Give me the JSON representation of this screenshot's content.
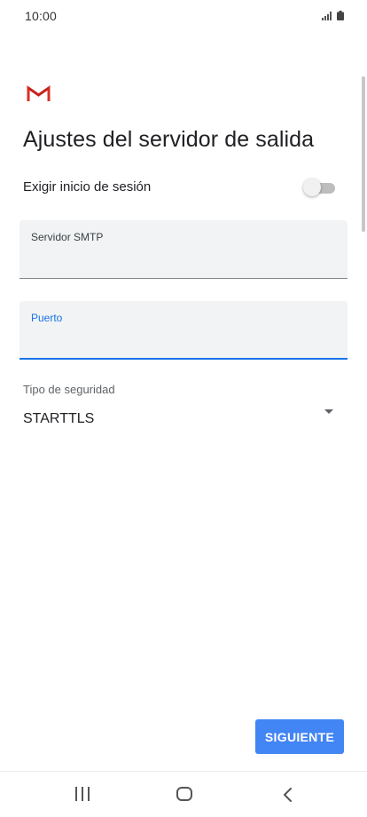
{
  "status_bar": {
    "time": "10:00",
    "icons": [
      "signal-icon",
      "battery-icon"
    ]
  },
  "app": {
    "logo": "gmail-logo"
  },
  "page": {
    "title": "Ajustes del servidor de salida"
  },
  "login_toggle": {
    "label": "Exigir inicio de sesión",
    "state": "off"
  },
  "smtp_server": {
    "label": "Servidor SMTP",
    "value": ""
  },
  "port": {
    "label": "Puerto",
    "value": "",
    "focused": true
  },
  "security": {
    "caption": "Tipo de seguridad",
    "selected": "STARTTLS"
  },
  "actions": {
    "next_label": "SIGUIENTE"
  },
  "nav_bar": {
    "icons": [
      "recents-icon",
      "home-icon",
      "back-icon"
    ]
  },
  "colors": {
    "accent": "#1a73e8",
    "button": "#4285f4",
    "field_background": "#f1f3f4",
    "gmail_red": "#d93025"
  }
}
